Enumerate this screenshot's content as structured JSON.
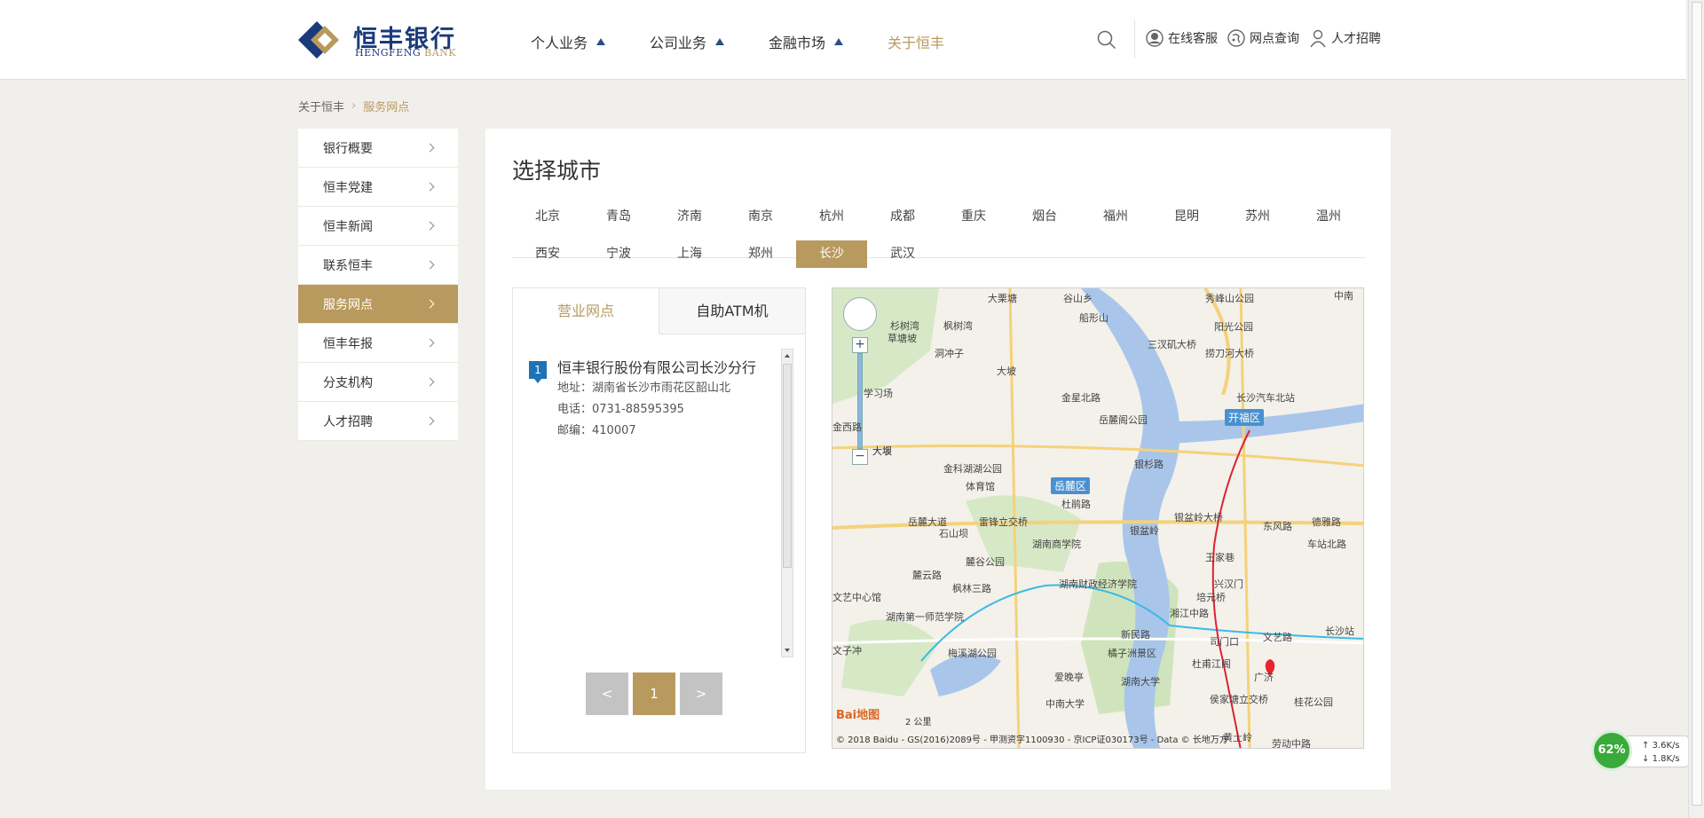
{
  "header": {
    "logo_cn": "恒丰银行",
    "logo_en_a": "HENGFENG",
    "logo_en_b": "BANK",
    "nav": [
      {
        "label": "个人业务",
        "dropdown": true
      },
      {
        "label": "公司业务",
        "dropdown": true
      },
      {
        "label": "金融市场",
        "dropdown": true
      },
      {
        "label": "关于恒丰",
        "dropdown": false,
        "active": true
      }
    ],
    "tools": [
      {
        "label": "在线客服",
        "icon": "customer-service-icon"
      },
      {
        "label": "网点查询",
        "icon": "branch-query-icon"
      },
      {
        "label": "人才招聘",
        "icon": "recruit-icon"
      }
    ]
  },
  "breadcrumb": {
    "parent": "关于恒丰",
    "sep": "›",
    "current": "服务网点"
  },
  "sidebar": {
    "items": [
      {
        "label": "银行概要"
      },
      {
        "label": "恒丰党建"
      },
      {
        "label": "恒丰新闻"
      },
      {
        "label": "联系恒丰"
      },
      {
        "label": "服务网点",
        "active": true
      },
      {
        "label": "恒丰年报"
      },
      {
        "label": "分支机构"
      },
      {
        "label": "人才招聘"
      }
    ]
  },
  "main": {
    "title": "选择城市",
    "cities_row1": [
      "北京",
      "青岛",
      "济南",
      "南京",
      "杭州",
      "成都",
      "重庆",
      "烟台",
      "福州",
      "昆明",
      "苏州",
      "温州"
    ],
    "cities_row2": [
      "西安",
      "宁波",
      "上海",
      "郑州",
      "长沙",
      "武汉"
    ],
    "active_city": "长沙",
    "tabs": [
      {
        "label": "营业网点",
        "active": true
      },
      {
        "label": "自助ATM机"
      }
    ],
    "branches": [
      {
        "index": "1",
        "name": "恒丰银行股份有限公司长沙分行",
        "address": "地址：湖南省长沙市雨花区韶山北",
        "phone": "电话：0731-88595395",
        "zip": "邮编：410007"
      }
    ],
    "pager": {
      "prev": "<",
      "current": "1",
      "next": ">"
    }
  },
  "map": {
    "labels": [
      {
        "text": "大栗塘"
      },
      {
        "text": "谷山乡"
      },
      {
        "text": "秀峰山公园"
      },
      {
        "text": "中南"
      },
      {
        "text": "杉树湾"
      },
      {
        "text": "枫树湾"
      },
      {
        "text": "船形山"
      },
      {
        "text": "阳光公园"
      },
      {
        "text": "草塘坡"
      },
      {
        "text": "洞冲子"
      },
      {
        "text": "三汊矶大桥"
      },
      {
        "text": "捞刀河大桥"
      },
      {
        "text": "大坡"
      },
      {
        "text": "金星北路"
      },
      {
        "text": "长沙汽车北站"
      },
      {
        "text": "岳麓阁公园"
      },
      {
        "text": "大坝"
      },
      {
        "text": "金科湖湖公园"
      },
      {
        "text": "银杉路"
      },
      {
        "text": "体育馆"
      },
      {
        "text": "杜鹃路"
      },
      {
        "text": "银盆岭大桥"
      },
      {
        "text": "岳麓大道"
      },
      {
        "text": "雷锋立交桥"
      },
      {
        "text": "银盆岭"
      },
      {
        "text": "东风路"
      },
      {
        "text": "德雅路"
      },
      {
        "text": "石山坝"
      },
      {
        "text": "湖南商学院"
      },
      {
        "text": "车站北路"
      },
      {
        "text": "麓谷公园"
      },
      {
        "text": "王家巷"
      },
      {
        "text": "湖南财政经济学院"
      },
      {
        "text": "兴汉门"
      },
      {
        "text": "麓云路"
      },
      {
        "text": "枫林三路"
      },
      {
        "text": "培元桥"
      },
      {
        "text": "湘江中路"
      },
      {
        "text": "湖南第一师范学院"
      },
      {
        "text": "新民路"
      },
      {
        "text": "司门口"
      },
      {
        "text": "文艺路"
      },
      {
        "text": "长沙站"
      },
      {
        "text": "梅溪湖公园"
      },
      {
        "text": "橘子洲景区"
      },
      {
        "text": "杜甫江阁"
      },
      {
        "text": "爱晚亭"
      },
      {
        "text": "湖南大学"
      },
      {
        "text": "广济"
      },
      {
        "text": "中南大学"
      },
      {
        "text": "侯家塘立交桥"
      },
      {
        "text": "桂花公园"
      },
      {
        "text": "黄土岭"
      },
      {
        "text": "劳动中路"
      },
      {
        "text": "文艺中心馆"
      },
      {
        "text": "文子冲"
      },
      {
        "text": "金西路"
      },
      {
        "text": "学习场"
      },
      {
        "text": "大坂"
      }
    ],
    "districts": [
      {
        "text": "开福区"
      },
      {
        "text": "岳麓区"
      }
    ],
    "scale": "2 公里",
    "baidu": "Bai地图",
    "copyright": "© 2018 Baidu - GS(2016)2089号 - 甲测资字1100930 - 京ICP证030173号 - Data © 长地万方"
  },
  "netmonitor": {
    "percent": "62%",
    "up": "3.6K/s",
    "down": "1.8K/s"
  },
  "colors": {
    "accent": "#b89a5e",
    "brand_blue": "#1a3a7a",
    "badge_blue": "#1c73b6"
  }
}
